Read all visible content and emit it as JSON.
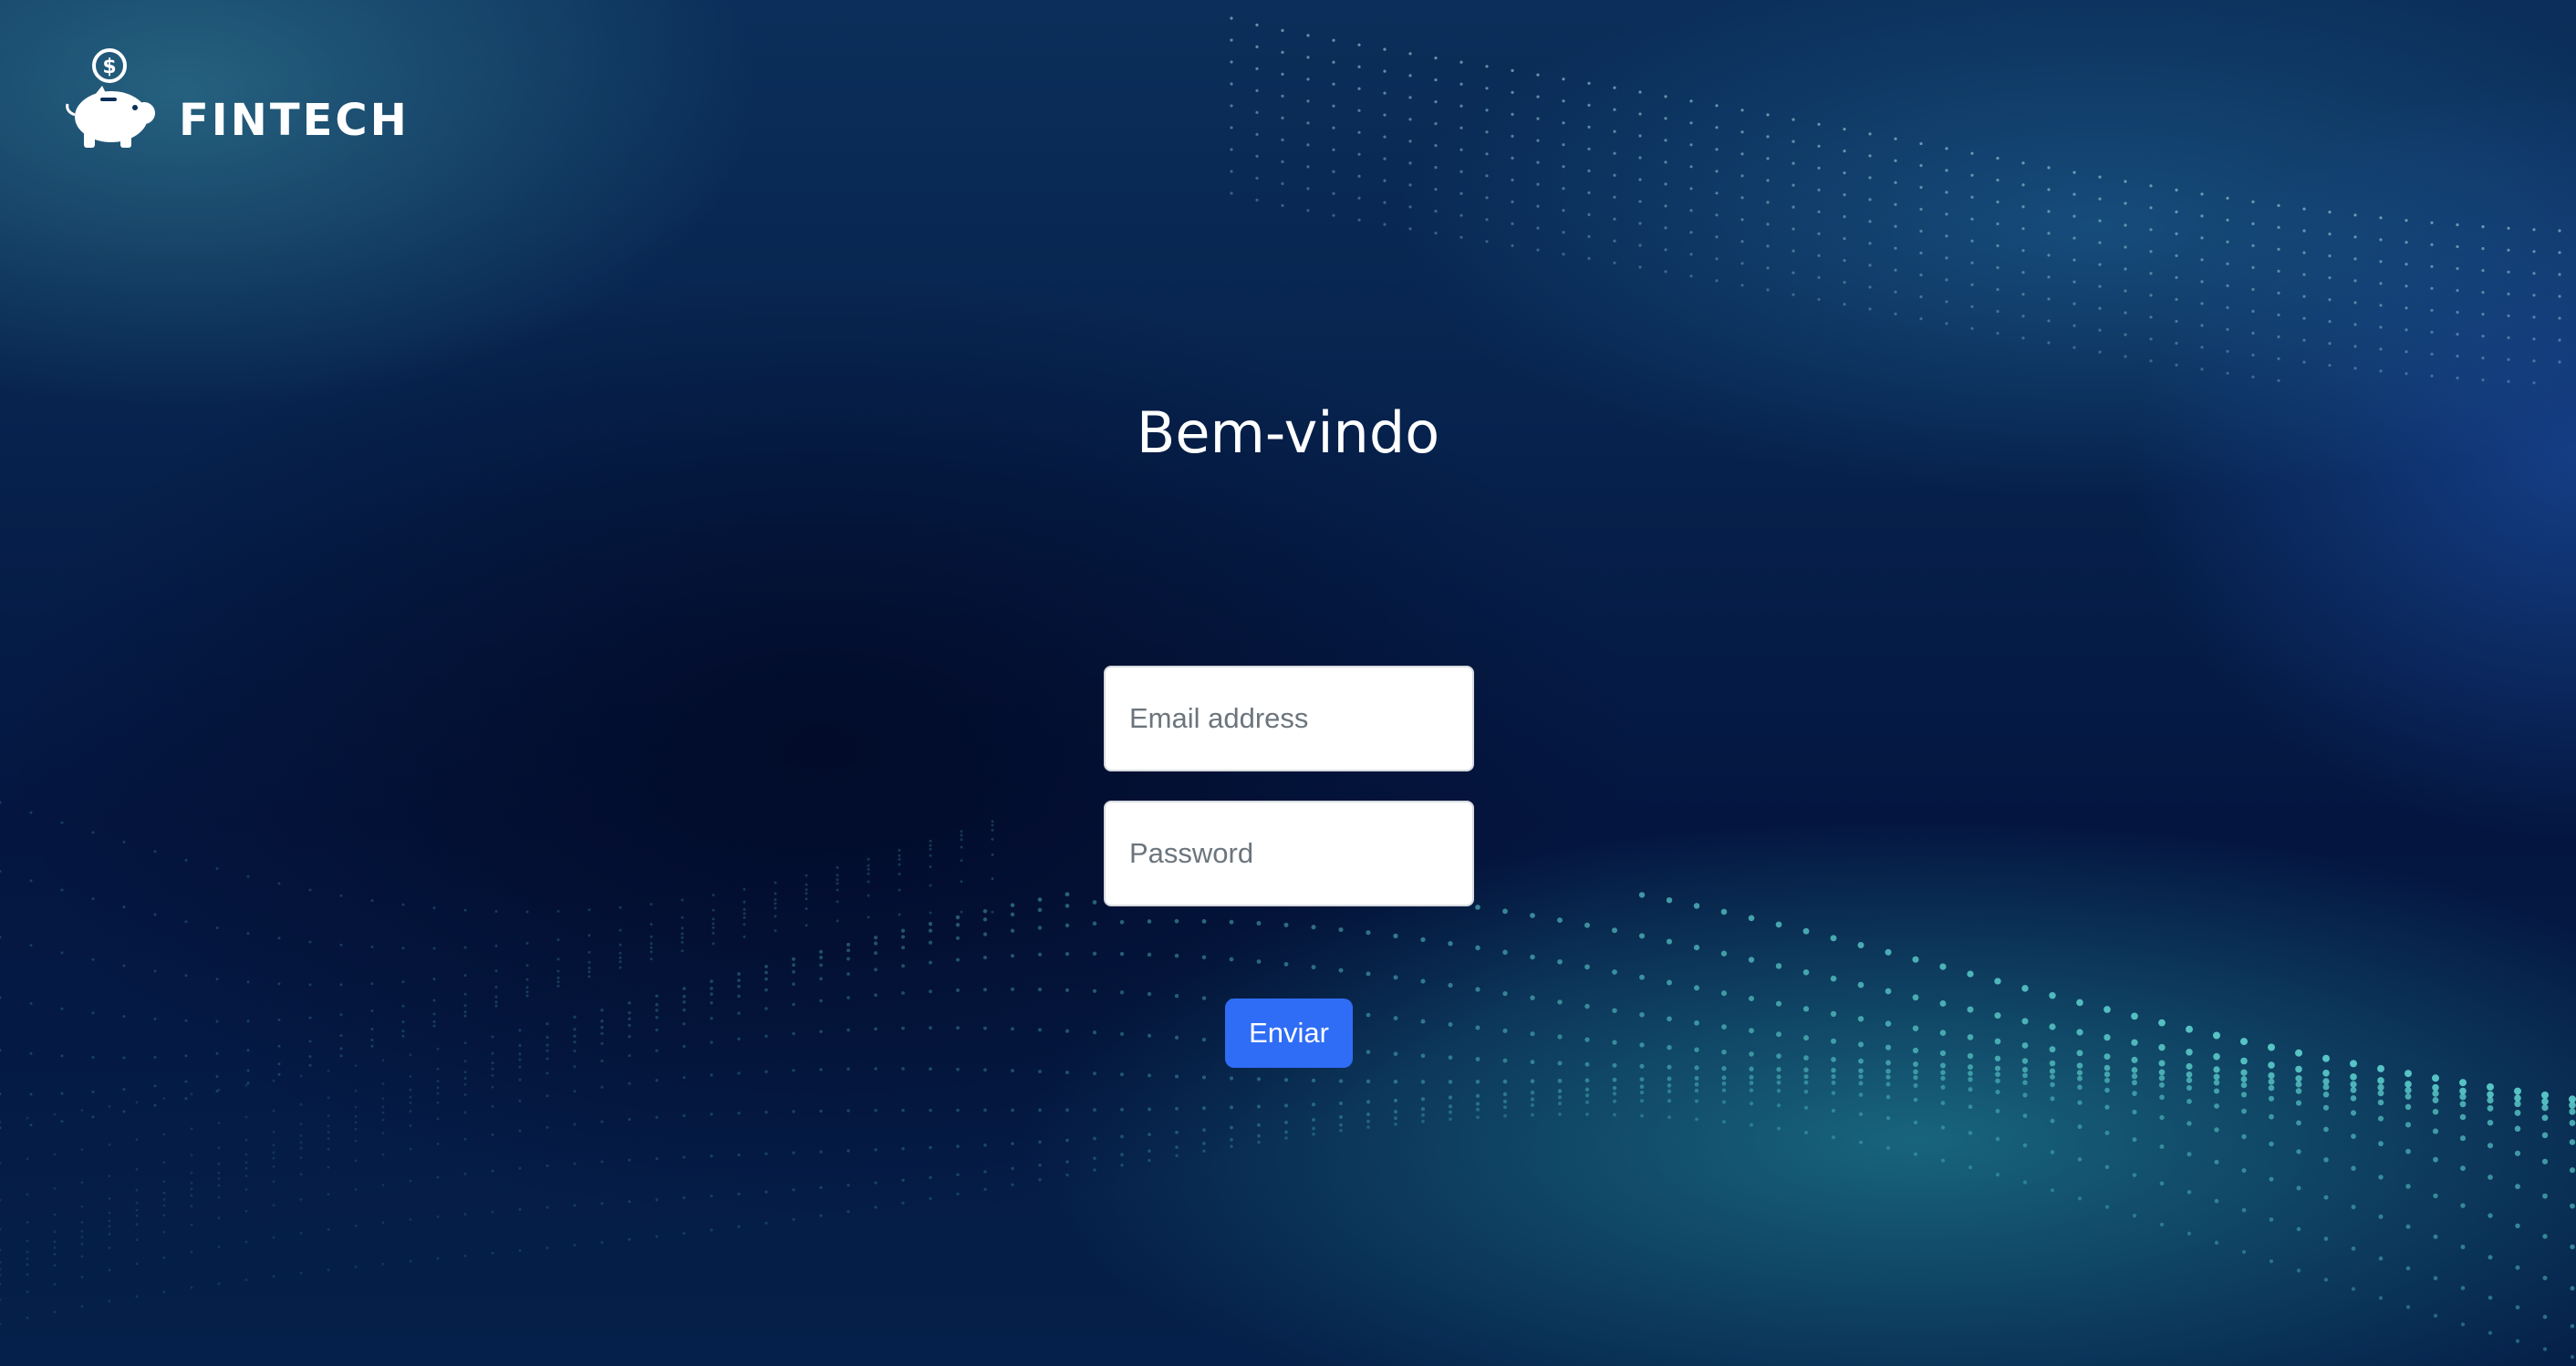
{
  "brand": {
    "name": "FINTECH",
    "logo_icon": "piggy-bank-coin-icon"
  },
  "login": {
    "title": "Bem-vindo",
    "email_placeholder": "Email address",
    "email_value": "",
    "password_placeholder": "Password",
    "password_value": "",
    "submit_label": "Enviar"
  },
  "colors": {
    "background_dark": "#041640",
    "accent_teal": "#5fd3d0",
    "button_blue": "#2f6df6"
  }
}
